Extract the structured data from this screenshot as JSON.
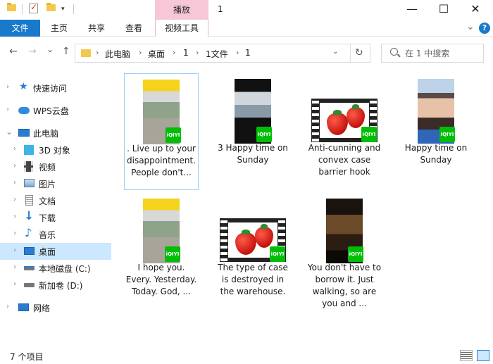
{
  "window": {
    "title": "1",
    "context_tab_header": "播放",
    "controls": {
      "minimize": "—",
      "maximize": "☐",
      "close": "✕"
    }
  },
  "quick_access": {
    "dropdown": "▾"
  },
  "ribbon": {
    "tabs": [
      "文件",
      "主页",
      "共享",
      "查看",
      "视频工具"
    ],
    "collapse_glyph": "⌄",
    "help_glyph": "?"
  },
  "nav": {
    "back": "←",
    "forward": "→",
    "recent": "⌄",
    "up": "↑",
    "breadcrumb": [
      "此电脑",
      "桌面",
      "1",
      "1文件",
      "1"
    ],
    "breadcrumb_sep": "›",
    "address_dropdown": "⌄",
    "refresh": "↻",
    "search_placeholder": "在 1 中搜索"
  },
  "sidebar": {
    "items": [
      {
        "label": "快速访问",
        "icon": "star-icon",
        "level": 0,
        "expander": "›"
      },
      {
        "label": "WPS云盘",
        "icon": "cloud-icon",
        "level": 0,
        "expander": "›"
      },
      {
        "label": "此电脑",
        "icon": "computer-icon",
        "level": 0,
        "expander": "⌄"
      },
      {
        "label": "3D 对象",
        "icon": "cube-icon",
        "level": 1,
        "expander": "›"
      },
      {
        "label": "视频",
        "icon": "video-icon",
        "level": 1,
        "expander": "›"
      },
      {
        "label": "图片",
        "icon": "picture-icon",
        "level": 1,
        "expander": "›"
      },
      {
        "label": "文档",
        "icon": "document-icon",
        "level": 1,
        "expander": "›"
      },
      {
        "label": "下载",
        "icon": "download-icon",
        "level": 1,
        "expander": "›"
      },
      {
        "label": "音乐",
        "icon": "music-icon",
        "level": 1,
        "expander": "›"
      },
      {
        "label": "桌面",
        "icon": "desktop-icon",
        "level": 1,
        "expander": "›",
        "selected": true
      },
      {
        "label": "本地磁盘 (C:)",
        "icon": "drive-icon",
        "level": 1,
        "expander": "›"
      },
      {
        "label": "新加卷 (D:)",
        "icon": "drive-icon",
        "level": 1,
        "expander": "›"
      },
      {
        "label": "网络",
        "icon": "network-icon",
        "level": 0,
        "expander": "›"
      }
    ]
  },
  "files": [
    {
      "label": ". Live up to your disappointment. People don't...",
      "thumb": "portrait-yellow",
      "badge": "iQIYI",
      "selected": true
    },
    {
      "label": "3 Happy time on Sunday",
      "thumb": "portrait-dark",
      "badge": "iQIYI"
    },
    {
      "label": "Anti-cunning and convex case barrier hook",
      "thumb": "film-strawberry",
      "badge": "iQIYI"
    },
    {
      "label": "Happy time on Sunday",
      "thumb": "portrait-woman",
      "badge": "iQIYI"
    },
    {
      "label": "I hope you. Every. Yesterday. Today. God, ...",
      "thumb": "portrait-yellow",
      "badge": "iQIYI"
    },
    {
      "label": "The type of case is destroyed in the warehouse.",
      "thumb": "film-strawberry",
      "badge": "iQIYI"
    },
    {
      "label": "You don't have to borrow it. Just walking, so are you and ...",
      "thumb": "portrait-night",
      "badge": "iQIYI"
    }
  ],
  "status": {
    "count": "7 个项目"
  },
  "colors": {
    "accent": "#1979ca",
    "context_tab": "#f7c7d8",
    "selected_bg": "#cce8ff",
    "badge": "#00be06"
  }
}
